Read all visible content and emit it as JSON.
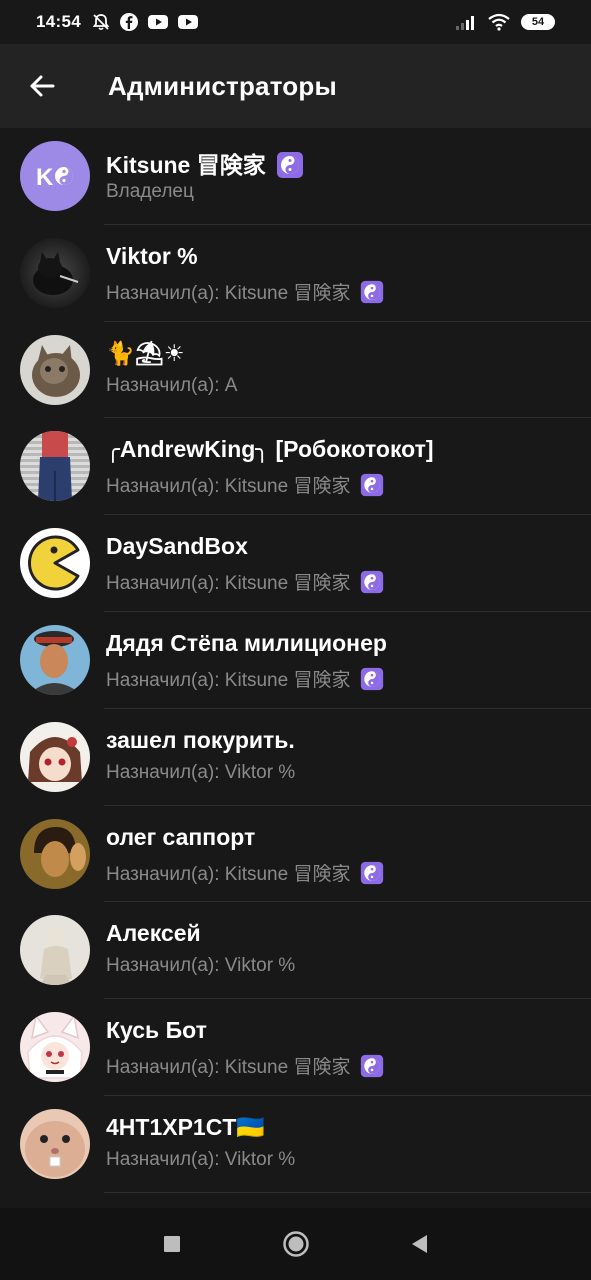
{
  "status_bar": {
    "time": "14:54",
    "battery": "54",
    "icons": [
      "mute-icon",
      "facebook-icon",
      "youtube-icon",
      "youtube-icon",
      "signal-icon",
      "wifi-icon",
      "battery-icon"
    ]
  },
  "header": {
    "title": "Администраторы",
    "back_icon": "arrow-left-icon"
  },
  "colors": {
    "background": "#181818",
    "appbar": "#232323",
    "secondary_text": "#8a8a8a",
    "kitsune_avatar": "#9c8ae6",
    "yin_yang_badge": "#8e6be6"
  },
  "admins": [
    {
      "name": "Kitsune 冒険家",
      "name_badge": true,
      "subtitle": "Владелец",
      "sub_badge": false,
      "avatar_text": "K"
    },
    {
      "name": "Viktor %",
      "name_badge": false,
      "subtitle": "Назначил(а): Kitsune 冒険家",
      "sub_badge": true
    },
    {
      "name": "🐈⛱☀",
      "name_badge": false,
      "subtitle": "Назначил(а): A",
      "sub_badge": false
    },
    {
      "name": "╭AndrewKing╮ [Робокотокот]",
      "name_badge": false,
      "subtitle": "Назначил(а): Kitsune 冒険家",
      "sub_badge": true
    },
    {
      "name": "DaySandBox",
      "name_badge": false,
      "subtitle": "Назначил(а): Kitsune 冒険家",
      "sub_badge": true
    },
    {
      "name": "Дядя Стёпа милиционер",
      "name_badge": false,
      "subtitle": "Назначил(а): Kitsune 冒険家",
      "sub_badge": true
    },
    {
      "name": "зашел покурить.",
      "name_badge": false,
      "subtitle": "Назначил(а): Viktor %",
      "sub_badge": false
    },
    {
      "name": "олег саппорт",
      "name_badge": false,
      "subtitle": "Назначил(а): Kitsune 冒険家",
      "sub_badge": true
    },
    {
      "name": "Алексей",
      "name_badge": false,
      "subtitle": "Назначил(а): Viktor %",
      "sub_badge": false
    },
    {
      "name": "Кусь Бот",
      "name_badge": false,
      "subtitle": "Назначил(а): Kitsune 冒険家",
      "sub_badge": true
    },
    {
      "name": "4HT1XP1CT🇺🇦",
      "name_badge": false,
      "subtitle": "Назначил(а): Viktor %",
      "sub_badge": false
    }
  ],
  "nav_bar": {
    "buttons": [
      "recents-square-icon",
      "home-circle-icon",
      "back-triangle-icon"
    ]
  }
}
